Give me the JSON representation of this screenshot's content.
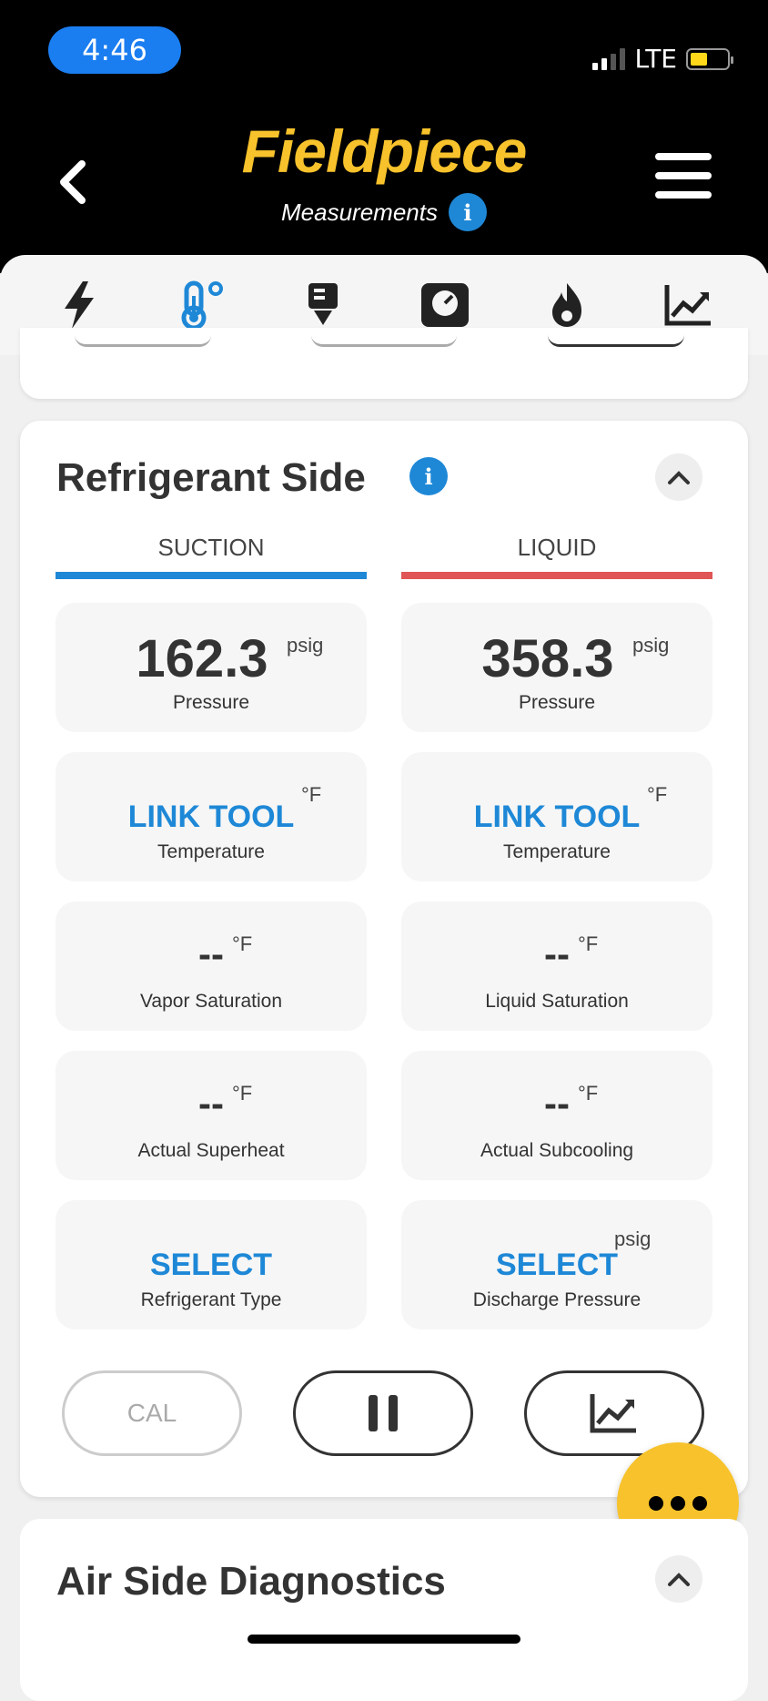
{
  "status_bar": {
    "time": "4:46",
    "network": "LTE"
  },
  "header": {
    "logo": "Fieldpiece",
    "subtitle": "Measurements"
  },
  "tabs": [
    "electrical-icon",
    "temperature-icon",
    "download-icon",
    "gauge-icon",
    "flame-icon",
    "chart-icon"
  ],
  "refrigerant": {
    "title": "Refrigerant Side",
    "suction_label": "SUCTION",
    "liquid_label": "LIQUID",
    "suction_pressure": {
      "value": "162.3",
      "unit": "psig",
      "label": "Pressure"
    },
    "liquid_pressure": {
      "value": "358.3",
      "unit": "psig",
      "label": "Pressure"
    },
    "suction_temp": {
      "value": "LINK TOOL",
      "unit": "°F",
      "label": "Temperature"
    },
    "liquid_temp": {
      "value": "LINK TOOL",
      "unit": "°F",
      "label": "Temperature"
    },
    "vapor_sat": {
      "value": "--",
      "unit": "°F",
      "label": "Vapor Saturation"
    },
    "liquid_sat": {
      "value": "--",
      "unit": "°F",
      "label": "Liquid Saturation"
    },
    "superheat": {
      "value": "--",
      "unit": "°F",
      "label": "Actual Superheat"
    },
    "subcooling": {
      "value": "--",
      "unit": "°F",
      "label": "Actual Subcooling"
    },
    "ref_type": {
      "value": "SELECT",
      "label": "Refrigerant Type"
    },
    "discharge": {
      "value": "SELECT",
      "unit": "psig",
      "label": "Discharge Pressure"
    },
    "cal_label": "CAL"
  },
  "air_side": {
    "title": "Air Side Diagnostics"
  },
  "colors": {
    "accent_blue": "#1e88d7",
    "suction_bar": "#1e88d7",
    "liquid_bar": "#e05555",
    "brand_yellow": "#f7c22b"
  }
}
